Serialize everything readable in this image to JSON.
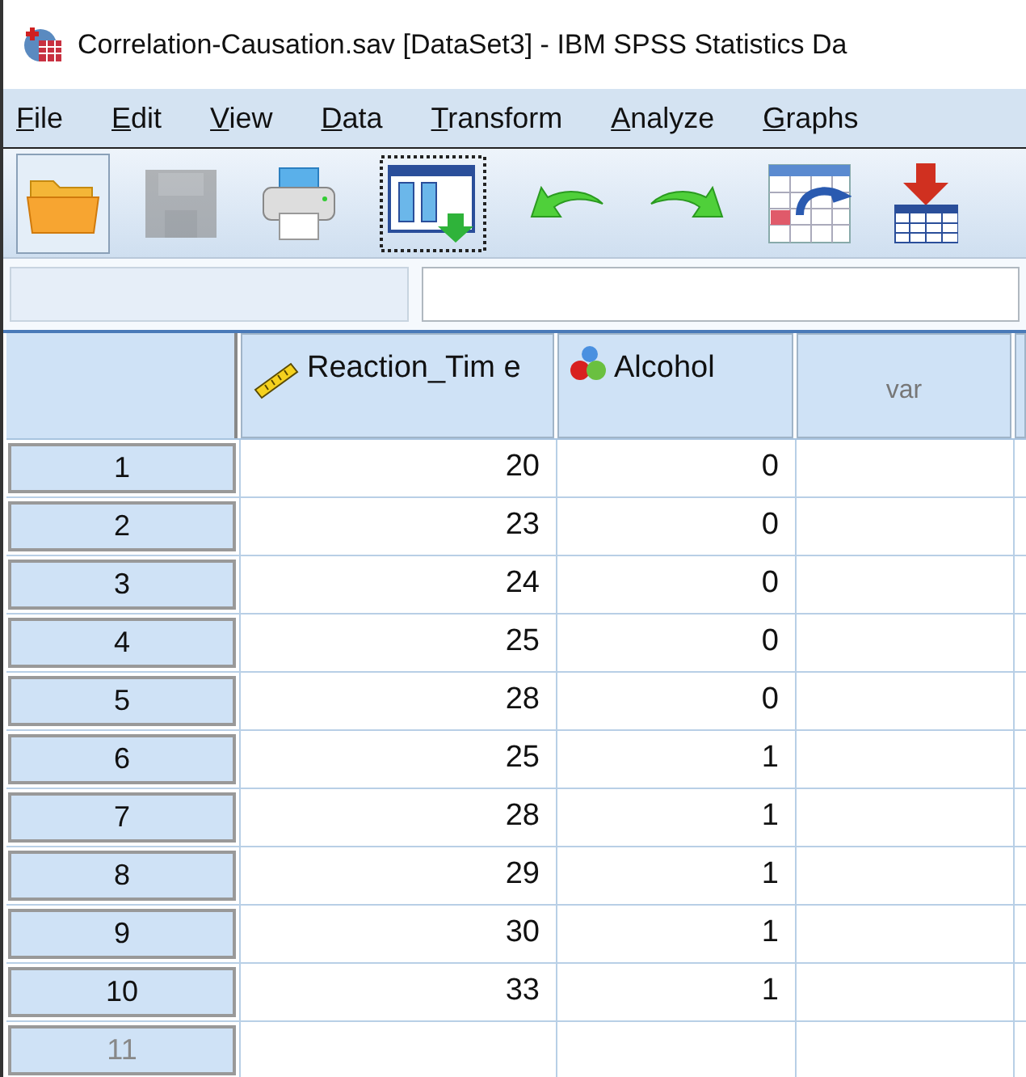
{
  "window": {
    "title": "Correlation-Causation.sav [DataSet3] - IBM SPSS Statistics Da"
  },
  "menu": [
    "File",
    "Edit",
    "View",
    "Data",
    "Transform",
    "Analyze",
    "Graphs"
  ],
  "toolbar": [
    {
      "kind": "open",
      "selected": true,
      "disabled": false
    },
    {
      "kind": "save",
      "selected": false,
      "disabled": true
    },
    {
      "kind": "print",
      "selected": false,
      "disabled": false
    },
    {
      "kind": "dialog",
      "selected": false,
      "disabled": false
    },
    {
      "kind": "undo",
      "selected": false,
      "disabled": false
    },
    {
      "kind": "redo",
      "selected": false,
      "disabled": false
    },
    {
      "kind": "goto",
      "selected": false,
      "disabled": false
    },
    {
      "kind": "import",
      "selected": false,
      "disabled": false
    }
  ],
  "table": {
    "columns": [
      {
        "label": "Reaction_Tim e",
        "kind": "scale"
      },
      {
        "label": "Alcohol",
        "kind": "nominal"
      },
      {
        "label": "var",
        "kind": "empty"
      }
    ],
    "rows": [
      {
        "number": "1",
        "cells": [
          "20",
          "0"
        ],
        "disabled": false
      },
      {
        "number": "2",
        "cells": [
          "23",
          "0"
        ],
        "disabled": false
      },
      {
        "number": "3",
        "cells": [
          "24",
          "0"
        ],
        "disabled": false
      },
      {
        "number": "4",
        "cells": [
          "25",
          "0"
        ],
        "disabled": false
      },
      {
        "number": "5",
        "cells": [
          "28",
          "0"
        ],
        "disabled": false
      },
      {
        "number": "6",
        "cells": [
          "25",
          "1"
        ],
        "disabled": false
      },
      {
        "number": "7",
        "cells": [
          "28",
          "1"
        ],
        "disabled": false
      },
      {
        "number": "8",
        "cells": [
          "29",
          "1"
        ],
        "disabled": false
      },
      {
        "number": "9",
        "cells": [
          "30",
          "1"
        ],
        "disabled": false
      },
      {
        "number": "10",
        "cells": [
          "33",
          "1"
        ],
        "disabled": false
      },
      {
        "number": "11",
        "cells": [],
        "disabled": true
      }
    ]
  }
}
